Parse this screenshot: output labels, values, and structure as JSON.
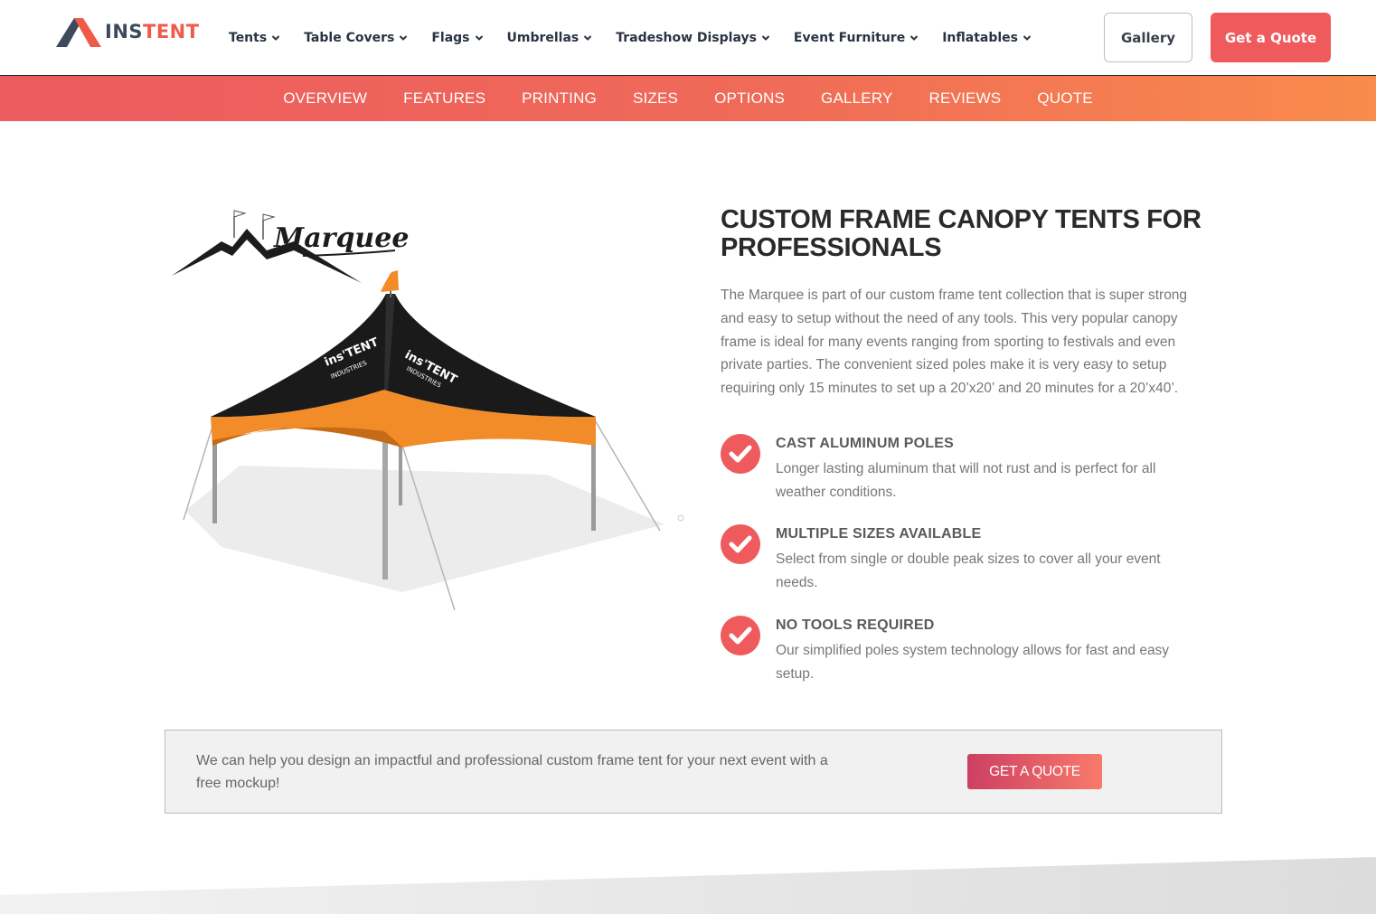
{
  "header": {
    "logo": {
      "ins": "INS",
      "tent": "TENT"
    },
    "nav": [
      {
        "label": "Tents"
      },
      {
        "label": "Table Covers"
      },
      {
        "label": "Flags"
      },
      {
        "label": "Umbrellas"
      },
      {
        "label": "Tradeshow Displays"
      },
      {
        "label": "Event Furniture"
      },
      {
        "label": "Inflatables"
      }
    ],
    "gallery_label": "Gallery",
    "quote_label": "Get a Quote"
  },
  "subnav": [
    {
      "label": "OVERVIEW"
    },
    {
      "label": "FEATURES"
    },
    {
      "label": "PRINTING"
    },
    {
      "label": "SIZES"
    },
    {
      "label": "OPTIONS"
    },
    {
      "label": "GALLERY"
    },
    {
      "label": "REVIEWS"
    },
    {
      "label": "QUOTE"
    }
  ],
  "product": {
    "logo_text": "Marquee",
    "tent_brand_top": "ins'TENT",
    "tent_brand_bottom": "INDUSTRIES"
  },
  "main": {
    "headline_line1": "CUSTOM FRAME CANOPY TENTS FOR",
    "headline_line2": "PROFESSIONALS",
    "intro": "The Marquee is part of our custom frame tent collection that is super strong and easy to setup without the need of any tools. This very popular canopy frame is ideal for many events ranging from sporting to festivals and even private parties. The convenient sized poles make it is very easy to setup requiring only 15 minutes to set up a 20’x20’ and 20 minutes for a 20’x40’.",
    "features": [
      {
        "title": "CAST ALUMINUM POLES",
        "desc": "Longer lasting aluminum that will not rust and is perfect for all weather conditions."
      },
      {
        "title": "MULTIPLE SIZES AVAILABLE",
        "desc": "Select from single or double peak sizes to cover all your event needs."
      },
      {
        "title": "NO TOOLS REQUIRED",
        "desc": "Our simplified poles system technology allows for fast and easy setup."
      }
    ]
  },
  "cta": {
    "text": "We can help you design an impactful and professional custom frame tent for your next event with a free mockup!",
    "button": "GET A QUOTE"
  },
  "colors": {
    "accent": "#ef5a5d",
    "subnav_start": "#ec5b5f",
    "subnav_end": "#f98b4c",
    "logo_dark": "#3c4a5c",
    "tent_black": "#1a1a1a",
    "tent_orange": "#f28c28"
  }
}
